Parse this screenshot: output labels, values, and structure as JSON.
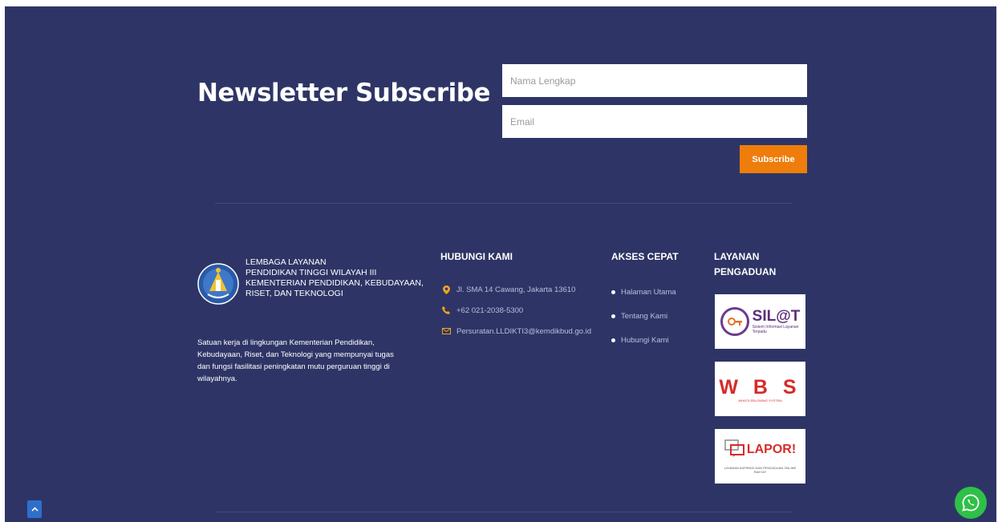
{
  "newsletter": {
    "title": "Newsletter Subscribe",
    "name_placeholder": "Nama Lengkap",
    "email_placeholder": "Email",
    "submit_label": "Subscribe"
  },
  "brand": {
    "org_lines": [
      "LEMBAGA LAYANAN",
      "PENDIDIKAN TINGGI WILAYAH III",
      "KEMENTERIAN PENDIDIKAN, KEBUDAYAAN,",
      "RISET, DAN TEKNOLOGI"
    ],
    "description": "Satuan kerja di lingkungan Kementerian Pendidikan, Kebudayaan, Riset, dan Teknologi yang mempunyai tugas dan fungsi fasilitasi peningkatan mutu perguruan tinggi di wilayahnya."
  },
  "contact": {
    "heading": "HUBUNGI KAMI",
    "items": [
      {
        "icon": "location-icon",
        "text": "Jl. SMA 14 Cawang, Jakarta 13610"
      },
      {
        "icon": "phone-icon",
        "text": "+62 021-2038-5300"
      },
      {
        "icon": "email-icon",
        "text": "Persuratan.LLDIKTI3@kemdikbud.go.id"
      }
    ]
  },
  "quick_access": {
    "heading": "AKSES CEPAT",
    "links": [
      "Halaman Utama",
      "Tentang Kami",
      "Hubungi Kami"
    ]
  },
  "complaints": {
    "heading_lines": [
      "LAYANAN",
      "PENGADUAN"
    ],
    "silat": {
      "brand": "SIL@T",
      "sub": "Sistem Informasi Layanan Terpadu"
    },
    "wbs": {
      "brand": "W B S",
      "sub": "WHISTLEBLOWING SYSTEM"
    },
    "lapor": {
      "brand": "LAPOR!",
      "sub": "LAYANAN ASPIRASI DAN PENGADUAN ONLINE RAKYAT"
    }
  },
  "colors": {
    "background": "#2e3566",
    "accent": "#ee7d0b",
    "whatsapp": "#2fc048",
    "back_to_top": "#2f6fcc"
  }
}
